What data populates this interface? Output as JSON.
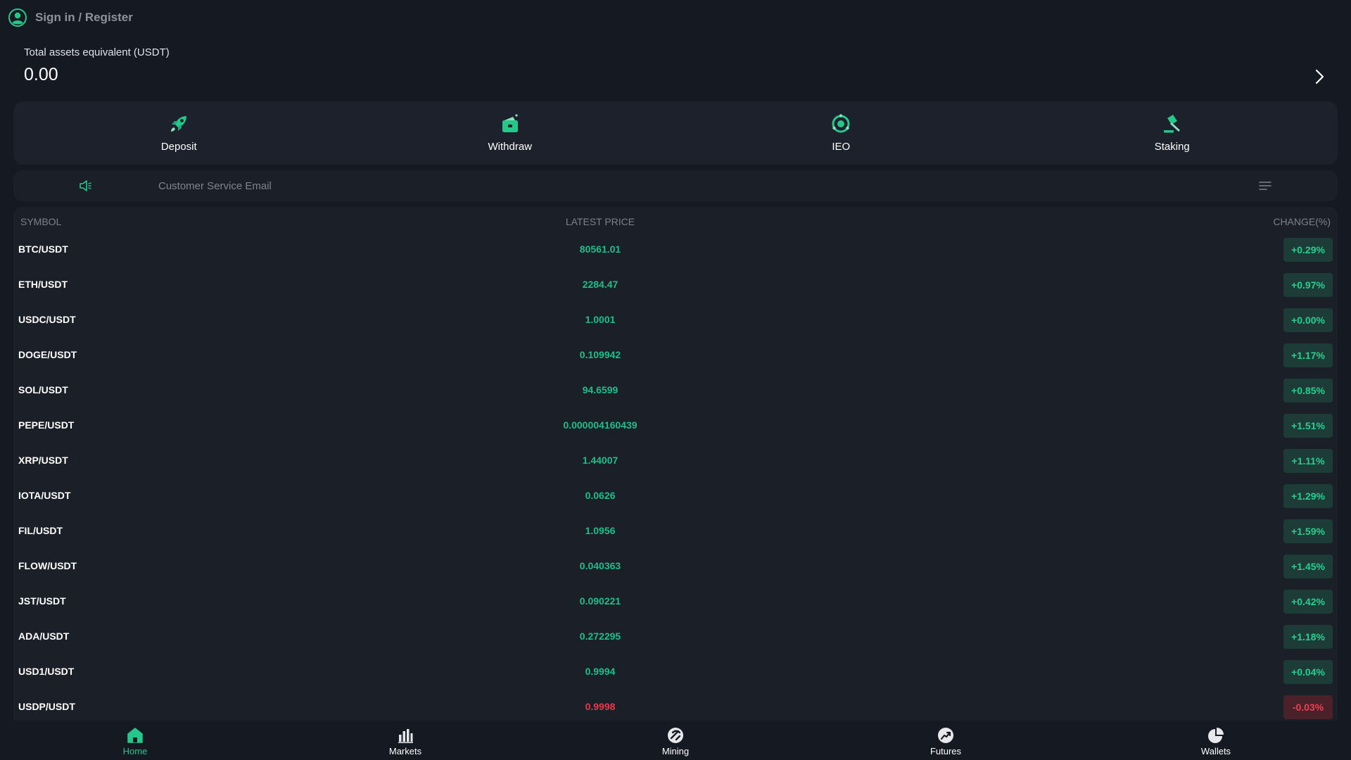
{
  "header": {
    "signin_label": "Sign in / Register"
  },
  "assets": {
    "label": "Total assets equivalent (USDT)",
    "value": "0.00"
  },
  "actions": [
    {
      "label": "Deposit",
      "icon": "rocket-icon"
    },
    {
      "label": "Withdraw",
      "icon": "wallet-icon"
    },
    {
      "label": "IEO",
      "icon": "target-icon"
    },
    {
      "label": "Staking",
      "icon": "hammer-icon"
    }
  ],
  "notice": {
    "text": "Customer Service Email"
  },
  "market": {
    "headers": {
      "symbol": "SYMBOL",
      "price": "LATEST PRICE",
      "change": "CHANGE(%)"
    },
    "rows": [
      {
        "symbol": "BTC/USDT",
        "price": "80561.01",
        "change": "+0.29%",
        "direction": "up"
      },
      {
        "symbol": "ETH/USDT",
        "price": "2284.47",
        "change": "+0.97%",
        "direction": "up"
      },
      {
        "symbol": "USDC/USDT",
        "price": "1.0001",
        "change": "+0.00%",
        "direction": "up"
      },
      {
        "symbol": "DOGE/USDT",
        "price": "0.109942",
        "change": "+1.17%",
        "direction": "up"
      },
      {
        "symbol": "SOL/USDT",
        "price": "94.6599",
        "change": "+0.85%",
        "direction": "up"
      },
      {
        "symbol": "PEPE/USDT",
        "price": "0.000004160439",
        "change": "+1.51%",
        "direction": "up"
      },
      {
        "symbol": "XRP/USDT",
        "price": "1.44007",
        "change": "+1.11%",
        "direction": "up"
      },
      {
        "symbol": "IOTA/USDT",
        "price": "0.0626",
        "change": "+1.29%",
        "direction": "up"
      },
      {
        "symbol": "FIL/USDT",
        "price": "1.0956",
        "change": "+1.59%",
        "direction": "up"
      },
      {
        "symbol": "FLOW/USDT",
        "price": "0.040363",
        "change": "+1.45%",
        "direction": "up"
      },
      {
        "symbol": "JST/USDT",
        "price": "0.090221",
        "change": "+0.42%",
        "direction": "up"
      },
      {
        "symbol": "ADA/USDT",
        "price": "0.272295",
        "change": "+1.18%",
        "direction": "up"
      },
      {
        "symbol": "USD1/USDT",
        "price": "0.9994",
        "change": "+0.04%",
        "direction": "up"
      },
      {
        "symbol": "USDP/USDT",
        "price": "0.9998",
        "change": "-0.03%",
        "direction": "down"
      }
    ]
  },
  "nav": [
    {
      "label": "Home",
      "icon": "home-icon",
      "active": true
    },
    {
      "label": "Markets",
      "icon": "bar-chart-icon",
      "active": false
    },
    {
      "label": "Mining",
      "icon": "mining-icon",
      "active": false
    },
    {
      "label": "Futures",
      "icon": "trend-icon",
      "active": false
    },
    {
      "label": "Wallets",
      "icon": "pie-chart-icon",
      "active": false
    }
  ],
  "colors": {
    "accent": "#26c88a",
    "up": "#1fbf8a",
    "down": "#e8384f",
    "background": "#151922"
  }
}
